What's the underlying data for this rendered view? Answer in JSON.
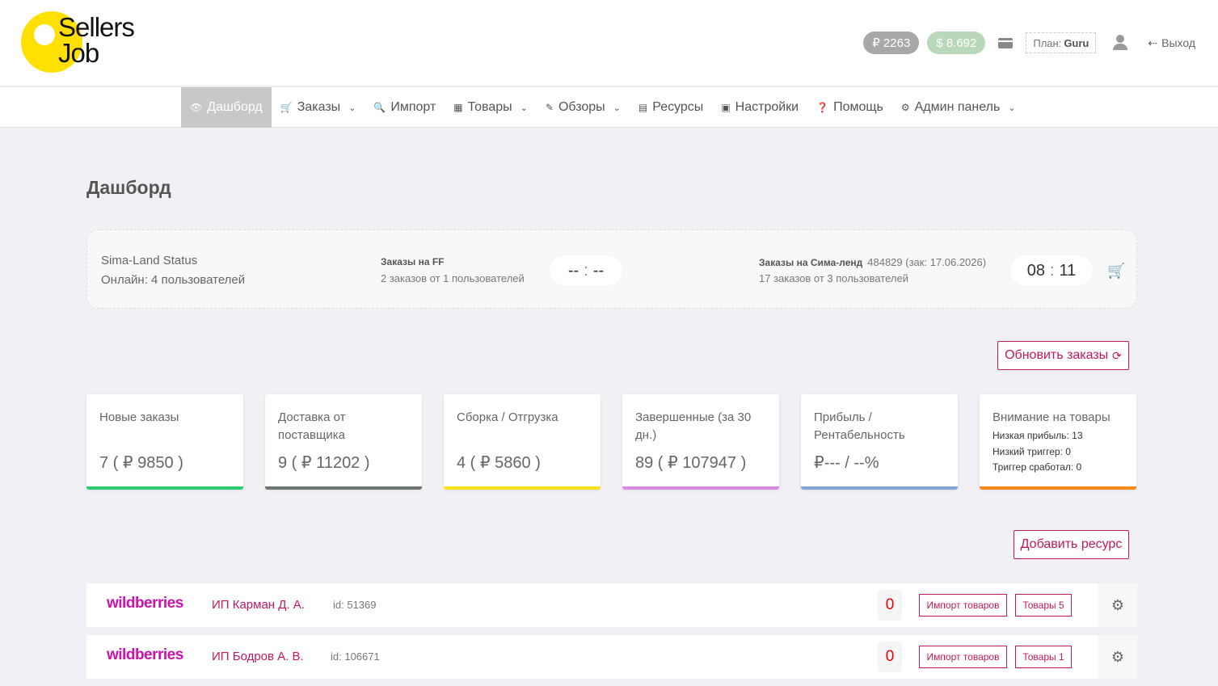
{
  "header": {
    "logo_line1": "Sellers",
    "logo_line2": "Job",
    "balance_rub": "₽ 2263",
    "balance_usd": "$ 8.692",
    "plan_label": "План:",
    "plan_value": "Guru",
    "logout_label": "Выход"
  },
  "nav": {
    "items": [
      {
        "label": "Дашборд",
        "icon": "👁"
      },
      {
        "label": "Заказы",
        "icon": "🛒"
      },
      {
        "label": "Импорт",
        "icon": "🔍"
      },
      {
        "label": "Товары",
        "icon": "▦"
      },
      {
        "label": "Обзоры",
        "icon": "✎"
      },
      {
        "label": "Ресурсы",
        "icon": "▤"
      },
      {
        "label": "Настройки",
        "icon": "▣"
      },
      {
        "label": "Помощь",
        "icon": "❓"
      },
      {
        "label": "Админ панель",
        "icon": "⚙"
      }
    ]
  },
  "page": {
    "title": "Дашборд"
  },
  "status": {
    "sima_land_title": "Sima-Land Status",
    "online_text": "Онлайн: 4 пользователей",
    "ff_title": "Заказы на FF",
    "ff_sub": "2 заказов от 1 пользователей",
    "ff_timer_left": "--",
    "ff_timer_right": "--",
    "sima_orders_title": "Заказы на Сима-ленд",
    "sima_orders_meta": "484829 (зак: 17.06.2026)",
    "sima_orders_sub": "17 заказов от 3 пользователей",
    "sima_timer_left": "08",
    "sima_timer_right": "11",
    "timer_sep": ":"
  },
  "buttons": {
    "refresh_orders": "Обновить заказы",
    "add_resource": "Добавить ресурс"
  },
  "stats": [
    {
      "label": "Новые заказы",
      "value": "7 ( ₽ 9850 )",
      "color": "#2ecc71"
    },
    {
      "label": "Доставка от поставщика",
      "value": "9 ( ₽ 11202 )",
      "color": "#6b7770"
    },
    {
      "label": "Сборка / Отгрузка",
      "value": "4 ( ₽ 5860 )",
      "color": "#f5e21a"
    },
    {
      "label": "Завершенные (за 30 дн.)",
      "value": "89 ( ₽ 107947 )",
      "color": "#d98ae0"
    },
    {
      "label": "Прибыль / Рентабельность",
      "value": "₽--- / --%",
      "color": "#7fa6d4"
    },
    {
      "label": "Внимание на товары",
      "lines": [
        "Низкая прибыль: 13",
        "Низкий триггер: 0",
        "Триггер сработал: 0"
      ],
      "color": "#f08a1c"
    }
  ],
  "resources": [
    {
      "brand": "wildberries",
      "name": "ИП Карман Д. А.",
      "id": "id: 51369",
      "count": "0",
      "import_label": "Импорт товаров",
      "goods_label": "Товары 5"
    },
    {
      "brand": "wildberries",
      "name": "ИП Бодров А. В.",
      "id": "id: 106671",
      "count": "0",
      "import_label": "Импорт товаров",
      "goods_label": "Товары 1"
    }
  ]
}
